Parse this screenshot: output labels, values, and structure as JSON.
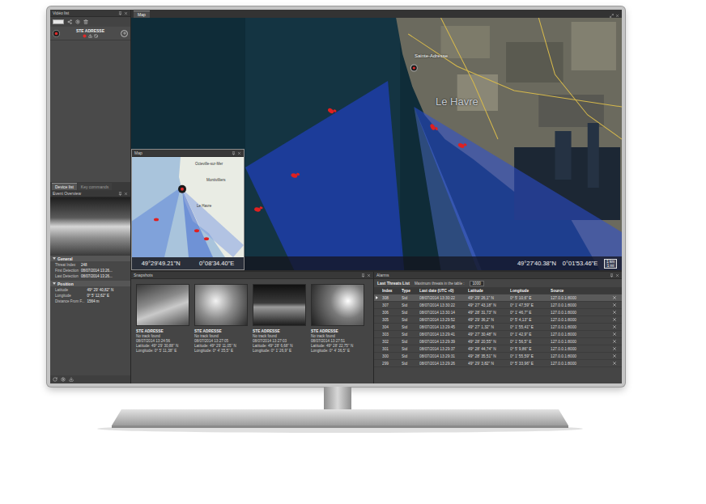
{
  "left_panel": {
    "title": "Vidéo list",
    "device": {
      "name": "STE ADRESSE",
      "recording": true
    },
    "tabs": [
      {
        "label": "Device list",
        "selected": true
      },
      {
        "label": "Key commands",
        "selected": false
      }
    ],
    "event_overview": {
      "title": "Event Overview"
    },
    "sections": [
      {
        "title": "General",
        "fields": [
          {
            "label": "Threat Index",
            "value": "248"
          },
          {
            "label": "First Detection",
            "value": "08/07/2014 13:26..."
          },
          {
            "label": "Last Detection",
            "value": "08/07/2014 13:26..."
          }
        ]
      },
      {
        "title": "Position",
        "fields": [
          {
            "label": "Latitude",
            "value": "49° 29' 40,82'' N"
          },
          {
            "label": "Longitude",
            "value": "0° 5' 12,62'' E"
          },
          {
            "label": "Distance From F...",
            "value": "1564 m"
          }
        ]
      }
    ]
  },
  "map": {
    "tab": "Map",
    "labels": [
      {
        "text": "Sainte-Adresse",
        "kind": "place"
      },
      {
        "text": "Le Havre",
        "kind": "city"
      }
    ],
    "latitude": "49°27'40.38\"N",
    "longitude": "0°01'53.46\"E",
    "scale": [
      "1 km",
      "1 mi"
    ],
    "inset": {
      "title": "Map",
      "latitude": "49°29'49.21\"N",
      "longitude": "0°08'34.40\"E",
      "labels": [
        "Octeville-sur-Mer",
        "Montivilliers",
        "Le Havre"
      ]
    }
  },
  "snapshots": {
    "title": "Snapshots",
    "items": [
      {
        "device": "STE ADRESSE",
        "status": "No track found",
        "time": "08/07/2014 13:24:56",
        "latitude": "Latitude: 49° 29' 30,88'' N",
        "longitude": "Longitude: 0° 5' 11,38'' E"
      },
      {
        "device": "STE ADRESSE",
        "status": "No track found",
        "time": "08/07/2014 13:27:05",
        "latitude": "Latitude: 49° 29' 11,05'' N",
        "longitude": "Longitude: 0° 4' 35,5'' E"
      },
      {
        "device": "STE ADRESSE",
        "status": "No track found",
        "time": "08/07/2014 13:27:03",
        "latitude": "Latitude: 49° 28' 6,68'' N",
        "longitude": "Longitude: 0° 1' 26,9'' E"
      },
      {
        "device": "STE ADRESSE",
        "status": "No track found",
        "time": "08/07/2014 13:27:51",
        "latitude": "Latitude: 49° 28' 22,75'' N",
        "longitude": "Longitude: 0° 4' 36,5'' E"
      }
    ]
  },
  "alarms": {
    "title": "Alarms",
    "list_title": "Last Threats List",
    "max_label": "Maximum threats in the table :",
    "max_value": "1000",
    "columns": [
      "Index",
      "Type",
      "Last date (UTC +0)",
      "Latitude",
      "Longitude",
      "Source"
    ],
    "rows": [
      {
        "index": "308",
        "type": "Std",
        "date": "08/07/2014 13:30:22",
        "latitude": "49° 29' 26,1\" N",
        "longitude": "0° 5' 10,6\" E",
        "source": "127.0.0.1:8000",
        "selected": true
      },
      {
        "index": "307",
        "type": "Std",
        "date": "08/07/2014 13:30:22",
        "latitude": "49° 27' 43,18\" N",
        "longitude": "0° 1' 47,59\" E",
        "source": "127.0.0.1:8000",
        "selected": false
      },
      {
        "index": "306",
        "type": "Std",
        "date": "08/07/2014 13:30:14",
        "latitude": "49° 28' 31,73\" N",
        "longitude": "0° 1' 46,7\" E",
        "source": "127.0.0.1:8000",
        "selected": false
      },
      {
        "index": "305",
        "type": "Std",
        "date": "08/07/2014 13:29:52",
        "latitude": "49° 29' 36,2\" N",
        "longitude": "0° 5' 4,13\" E",
        "source": "127.0.0.1:8000",
        "selected": false
      },
      {
        "index": "304",
        "type": "Std",
        "date": "08/07/2014 13:29:45",
        "latitude": "49° 27' 1,32\" N",
        "longitude": "0° 1' 55,41\" E",
        "source": "127.0.0.1:8000",
        "selected": false
      },
      {
        "index": "303",
        "type": "Std",
        "date": "08/07/2014 13:29:41",
        "latitude": "49° 27' 30,48\" N",
        "longitude": "0° 1' 42,9\" E",
        "source": "127.0.0.1:8000",
        "selected": false
      },
      {
        "index": "302",
        "type": "Std",
        "date": "08/07/2014 13:29:39",
        "latitude": "49° 28' 20,55\" N",
        "longitude": "0° 1' 56,5\" E",
        "source": "127.0.0.1:8000",
        "selected": false
      },
      {
        "index": "301",
        "type": "Std",
        "date": "08/07/2014 13:29:37",
        "latitude": "49° 28' 44,74\" N",
        "longitude": "0° 5' 9,86\" E",
        "source": "127.0.0.1:8000",
        "selected": false
      },
      {
        "index": "300",
        "type": "Std",
        "date": "08/07/2014 13:29:31",
        "latitude": "49° 28' 35,51\" N",
        "longitude": "0° 1' 55,59\" E",
        "source": "127.0.0.1:8000",
        "selected": false
      },
      {
        "index": "299",
        "type": "Std",
        "date": "08/07/2014 13:29:26",
        "latitude": "49° 29' 3,82\" N",
        "longitude": "0° 5' 33,96\" E",
        "source": "127.0.0.1:8000",
        "selected": false
      }
    ]
  }
}
